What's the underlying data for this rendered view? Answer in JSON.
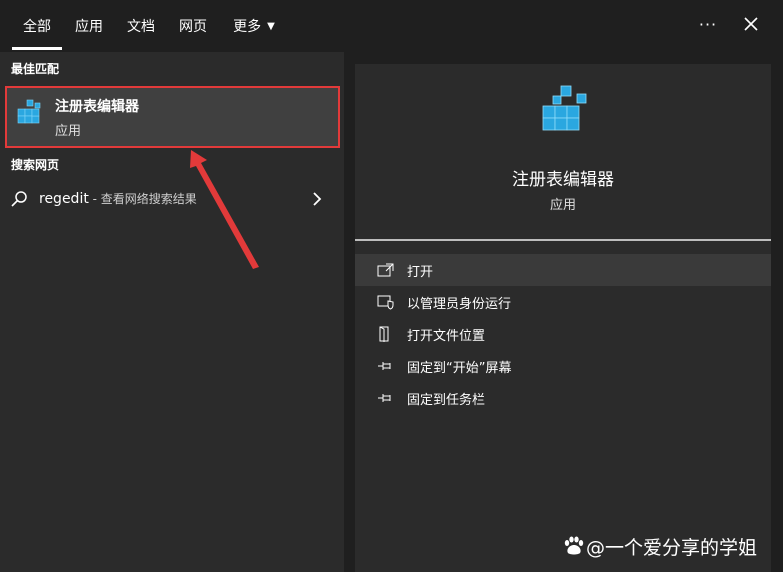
{
  "tabs": [
    {
      "label": "全部",
      "active": true
    },
    {
      "label": "应用",
      "active": false
    },
    {
      "label": "文档",
      "active": false
    },
    {
      "label": "网页",
      "active": false
    },
    {
      "label": "更多",
      "active": false,
      "has_caret": true
    }
  ],
  "more_menu_icon": "ellipsis-icon",
  "close_icon": "close-icon",
  "left": {
    "best_match_header": "最佳匹配",
    "best_match": {
      "title": "注册表编辑器",
      "subtitle": "应用",
      "icon": "registry-editor-icon"
    },
    "web_header": "搜索网页",
    "web_result": {
      "query": "regedit",
      "hint": " - 查看网络搜索结果",
      "icon": "search-icon"
    }
  },
  "right": {
    "app_name": "注册表编辑器",
    "app_type": "应用",
    "actions": [
      {
        "label": "打开",
        "icon": "open-icon"
      },
      {
        "label": "以管理员身份运行",
        "icon": "shield-icon"
      },
      {
        "label": "打开文件位置",
        "icon": "file-location-icon"
      },
      {
        "label": "固定到“开始”屏幕",
        "icon": "pin-icon"
      },
      {
        "label": "固定到任务栏",
        "icon": "pin-icon"
      }
    ]
  },
  "watermark": "@一个爱分享的学姐",
  "colors": {
    "highlight_border": "#e23a3a",
    "annotation_arrow": "#e23a3a",
    "icon_blue": "#2aa7e0"
  }
}
